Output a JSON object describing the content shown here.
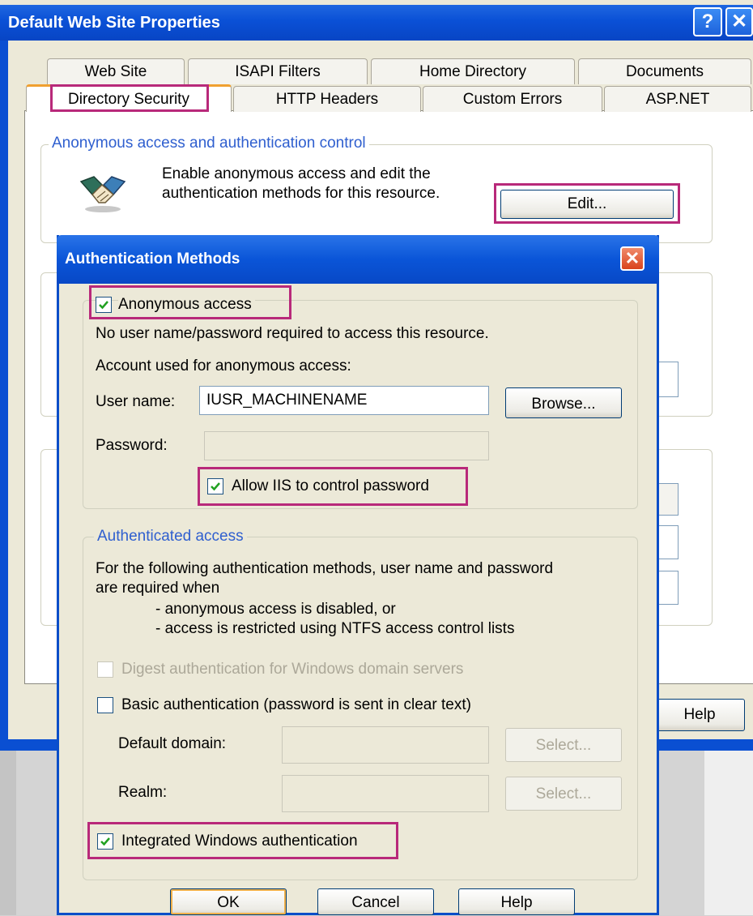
{
  "background_window": {
    "title": "Default Web Site Properties",
    "help_glyph": "?",
    "close_glyph": "✕",
    "tabs_row1": [
      "Web Site",
      "ISAPI Filters",
      "Home Directory",
      "Documents"
    ],
    "tabs_row2": [
      "Directory Security",
      "HTTP Headers",
      "Custom Errors",
      "ASP.NET"
    ],
    "active_tab": "Directory Security",
    "anon_group": {
      "label": "Anonymous access and authentication control",
      "icon": "handshake-icon",
      "description_line1": "Enable anonymous access and edit the",
      "description_line2": "authentication methods for this resource.",
      "edit_button": "Edit..."
    },
    "help_button": "Help"
  },
  "dialog": {
    "title": "Authentication Methods",
    "close_glyph": "✕",
    "anonymous": {
      "checkbox_label": "Anonymous access",
      "checked": true,
      "note": "No user name/password required to access this resource.",
      "account_label": "Account used for anonymous access:",
      "username_label": "User name:",
      "username_value": "IUSR_MACHINENAME",
      "browse_button": "Browse...",
      "password_label": "Password:",
      "allow_iis_label": "Allow IIS to control password",
      "allow_iis_checked": true
    },
    "authenticated": {
      "group_label": "Authenticated access",
      "intro_line1": "For the following authentication methods, user name and password",
      "intro_line2": "are required when",
      "bullet1": "- anonymous access is disabled, or",
      "bullet2": "- access is restricted using NTFS access control lists",
      "digest_label": "Digest authentication for Windows domain servers",
      "basic_label": "Basic authentication (password is sent in clear text)",
      "default_domain_label": "Default domain:",
      "realm_label": "Realm:",
      "select_button": "Select...",
      "integrated_label": "Integrated Windows authentication",
      "integrated_checked": true
    },
    "buttons": {
      "ok": "OK",
      "cancel": "Cancel",
      "help": "Help"
    }
  },
  "colors": {
    "titlebar_blue": "#0a50d6",
    "highlight_magenta": "#b8297a",
    "window_face": "#ece9d8",
    "group_label_blue": "#2f5fcf",
    "check_green": "#21a121"
  }
}
